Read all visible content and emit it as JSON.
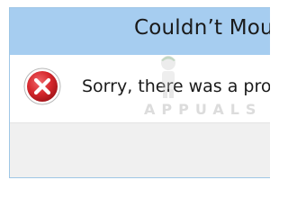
{
  "dialog": {
    "title": "Couldn’t Mou",
    "message": "Sorry, there was a probl",
    "icon": "error-icon"
  },
  "watermark": {
    "text": "APPUALS"
  },
  "colors": {
    "titlebar": "#a6cdf0",
    "footer": "#f0f0f0",
    "error_red": "#d6282d"
  }
}
